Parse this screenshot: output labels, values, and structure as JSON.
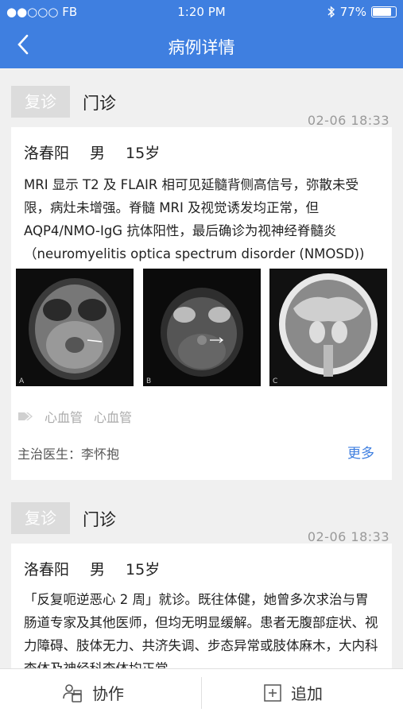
{
  "status": {
    "carrier": "●●○○○ FB",
    "time": "1:20 PM",
    "battery": "77%",
    "battery_level": 0.77
  },
  "nav": {
    "title": "病例详情"
  },
  "records": [
    {
      "tag": "复诊",
      "type": "门诊",
      "time": "02-06  18:33",
      "name": "洛春阳",
      "gender": "男",
      "age": "15岁",
      "description": "MRI 显示 T2 及 FLAIR 相可见延髓背侧高信号，弥散未受限，病灶未增强。脊髓 MRI 及视觉诱发均正常，但 AQP4/NMO-IgG 抗体阳性，最后确诊为视神经脊髓炎（neuromyelitis optica spectrum disorder (NMOSD))",
      "tags": [
        "心血管",
        "心血管"
      ],
      "doctor": "主治医生：李怀抱",
      "more": "更多"
    },
    {
      "tag": "复诊",
      "type": "门诊",
      "time": "02-06  18:33",
      "name": "洛春阳",
      "gender": "男",
      "age": "15岁",
      "description": "「反复呃逆恶心 2 周」就诊。既往体健，她曾多次求治与胃肠道专家及其他医师，但均无明显缓解。患者无腹部症状、视力障碍、肢体无力、共济失调、步态异常或肢体麻木，大内科查体及神经科查体均正常"
    }
  ],
  "bottom": {
    "collab": "协作",
    "add": "追加"
  }
}
